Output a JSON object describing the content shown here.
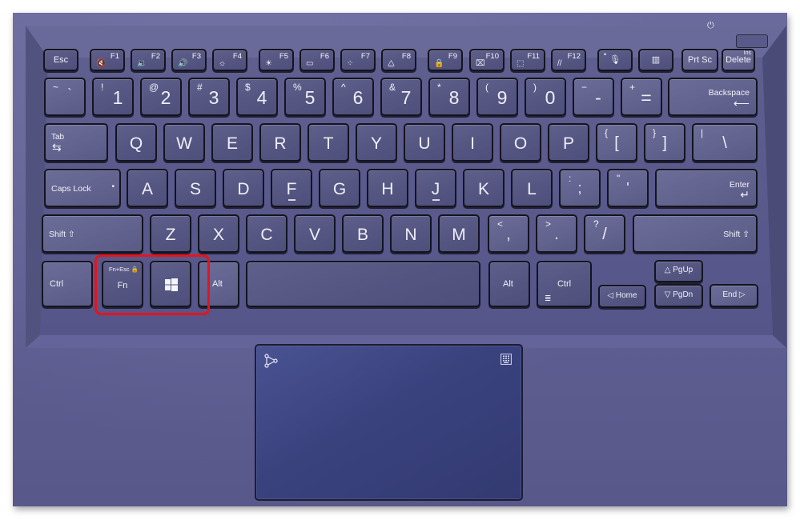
{
  "scene": {
    "description": "Laptop keyboard and touchpad photo with Fn and Windows keys highlighted",
    "highlight_color": "#e8131b",
    "deck_color": "#5f5f90",
    "touchpad_color": "#3a427e"
  },
  "power": {
    "icon": "power-icon",
    "glyph": "⏻"
  },
  "function_row": [
    {
      "label": "Esc"
    },
    {
      "label": "F1",
      "icon": "mute-icon",
      "glyph": "🔇"
    },
    {
      "label": "F2",
      "icon": "volume-down-icon",
      "glyph": "🔉"
    },
    {
      "label": "F3",
      "icon": "volume-up-icon",
      "glyph": "🔊"
    },
    {
      "label": "F4",
      "icon": "brightness-down-icon",
      "glyph": "☼"
    },
    {
      "label": "F5",
      "icon": "brightness-up-icon",
      "glyph": "☀"
    },
    {
      "label": "F6",
      "icon": "touchpad-toggle-icon",
      "glyph": "▭"
    },
    {
      "label": "F7",
      "icon": "keyboard-backlight-icon",
      "glyph": "⁘"
    },
    {
      "label": "F8",
      "icon": "display-switch-icon",
      "glyph": "⧋"
    },
    {
      "label": "F9",
      "icon": "lock-screen-icon",
      "glyph": "🔒"
    },
    {
      "label": "F10",
      "icon": "camera-off-icon",
      "glyph": "⌧"
    },
    {
      "label": "F11",
      "icon": "screenshot-icon",
      "glyph": "⬚"
    },
    {
      "label": "F12",
      "icon": "myasus-icon",
      "glyph": "//"
    },
    {
      "label": "",
      "icon": "mic-mute-icon",
      "glyph": "🎙"
    },
    {
      "label": "",
      "icon": "audio-wizard-icon",
      "glyph": "▥"
    },
    {
      "label": "Prt Sc"
    },
    {
      "label": "Delete",
      "sub": "Ins"
    }
  ],
  "number_row": [
    {
      "main": "`",
      "shift": "~"
    },
    {
      "main": "1",
      "shift": "!"
    },
    {
      "main": "2",
      "shift": "@"
    },
    {
      "main": "3",
      "shift": "#"
    },
    {
      "main": "4",
      "shift": "$"
    },
    {
      "main": "5",
      "shift": "%"
    },
    {
      "main": "6",
      "shift": "^"
    },
    {
      "main": "7",
      "shift": "&"
    },
    {
      "main": "8",
      "shift": "*"
    },
    {
      "main": "9",
      "shift": "("
    },
    {
      "main": "0",
      "shift": ")"
    },
    {
      "main": "-",
      "shift": "−"
    },
    {
      "main": "=",
      "shift": "+"
    },
    {
      "main": "Backspace",
      "arrow": "⟵"
    }
  ],
  "qwerty_row": {
    "tab": {
      "label": "Tab",
      "arrow": "⇆"
    },
    "letters": [
      "Q",
      "W",
      "E",
      "R",
      "T",
      "Y",
      "U",
      "I",
      "O",
      "P"
    ],
    "symbols": [
      {
        "main": "[",
        "shift": "{"
      },
      {
        "main": "]",
        "shift": "}"
      },
      {
        "main": "\\",
        "shift": "|"
      }
    ]
  },
  "home_row": {
    "caps": {
      "label": "Caps Lock",
      "indicator": "•"
    },
    "letters": [
      "A",
      "S",
      "D",
      "F",
      "G",
      "H",
      "J",
      "K",
      "L"
    ],
    "symbols": [
      {
        "main": ";",
        "shift": ":"
      },
      {
        "main": "'",
        "shift": "\""
      }
    ],
    "enter": {
      "label": "Enter",
      "arrow": "↵"
    }
  },
  "shift_row": {
    "left_shift": "Shift ⇧",
    "letters": [
      "Z",
      "X",
      "C",
      "V",
      "B",
      "N",
      "M"
    ],
    "symbols": [
      {
        "main": ",",
        "shift": "<"
      },
      {
        "main": ".",
        "shift": ">"
      },
      {
        "main": "/",
        "shift": "?"
      }
    ],
    "right_shift": "Shift ⇧"
  },
  "bottom_row": {
    "ctrl_left": "Ctrl",
    "fn": {
      "label": "Fn",
      "sub": "Fn+Esc 🔒"
    },
    "win": {
      "icon": "windows-logo-icon"
    },
    "alt_left": "Alt",
    "space": "",
    "alt_right": "Alt",
    "ctrl_right": {
      "label": "Ctrl",
      "icon": "menu-icon",
      "glyph": "≣"
    },
    "home": "◁ Home",
    "pgup": "△ PgUp",
    "pgdn": "▽ PgDn",
    "end": "End ▷"
  },
  "touchpad": {
    "left_icon": "gesture-icon",
    "right_icon": "numberpad-icon"
  }
}
